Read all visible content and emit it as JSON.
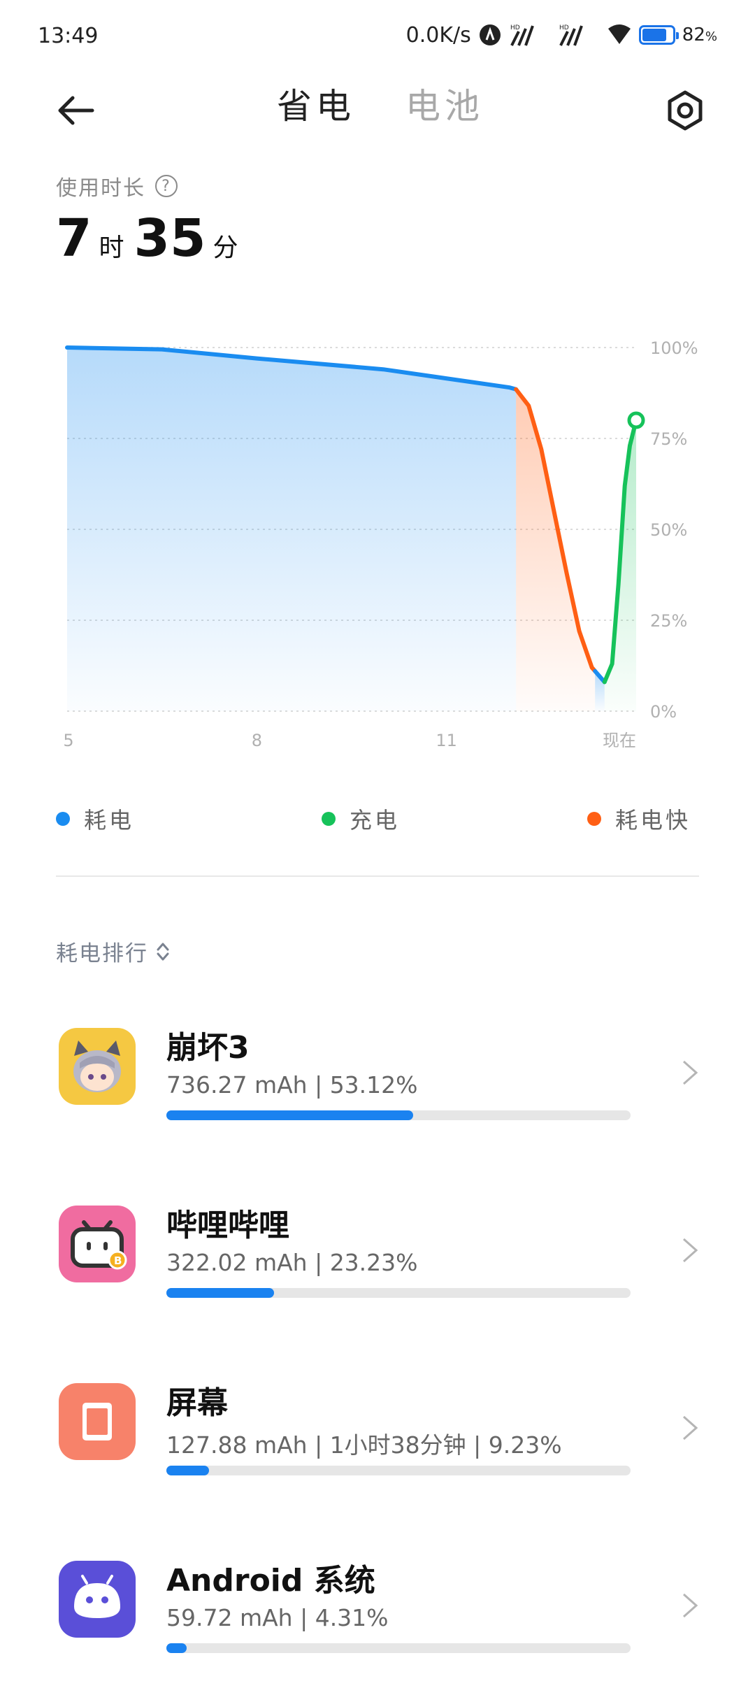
{
  "status_bar": {
    "time": "13:49",
    "net_speed": "0.0K/s",
    "battery_percent_text": "82",
    "battery_level": 0.82
  },
  "header": {
    "tab_active": "省电",
    "tab_inactive": "电池"
  },
  "usage": {
    "label": "使用时长",
    "hours": "7",
    "hours_unit": "时",
    "minutes": "35",
    "minutes_unit": "分"
  },
  "chart_data": {
    "type": "line",
    "x_tick_labels": [
      "5",
      "8",
      "11",
      "现在"
    ],
    "y_tick_labels": [
      "100%",
      "75%",
      "50%",
      "25%",
      "0%"
    ],
    "ylim": [
      0,
      100
    ],
    "grid": true,
    "series": [
      {
        "name": "耗电",
        "color": "#1a8cf0",
        "points": [
          [
            0,
            100
          ],
          [
            1.5,
            99.5
          ],
          [
            3,
            97
          ],
          [
            5,
            94
          ],
          [
            7,
            89
          ],
          [
            7.1,
            88.5
          ]
        ]
      },
      {
        "name": "耗电快",
        "color": "#ff5f14",
        "points": [
          [
            7.1,
            88.5
          ],
          [
            7.3,
            84
          ],
          [
            7.5,
            72
          ],
          [
            7.7,
            55
          ],
          [
            7.9,
            38
          ],
          [
            8.1,
            22
          ],
          [
            8.3,
            12
          ],
          [
            8.35,
            11
          ]
        ]
      },
      {
        "name": "耗电",
        "color": "#1a8cf0",
        "points": [
          [
            8.35,
            11
          ],
          [
            8.5,
            8
          ]
        ]
      },
      {
        "name": "充电",
        "color": "#16c25a",
        "points": [
          [
            8.5,
            8
          ],
          [
            8.62,
            13
          ],
          [
            8.72,
            35
          ],
          [
            8.82,
            62
          ],
          [
            8.9,
            73
          ],
          [
            9,
            80
          ]
        ]
      }
    ],
    "x_range": [
      0,
      9
    ],
    "legend": [
      "耗电",
      "充电",
      "耗电快"
    ]
  },
  "legend": [
    {
      "label": "耗电",
      "color": "#1a8cf0"
    },
    {
      "label": "充电",
      "color": "#16c25a"
    },
    {
      "label": "耗电快",
      "color": "#ff5f14"
    }
  ],
  "ranking": {
    "title": "耗电排行",
    "items": [
      {
        "name": "崩坏3",
        "detail": "736.27 mAh | 53.12%",
        "percent": 53.12,
        "icon": "honkai-icon",
        "icon_bg": "#f5c842"
      },
      {
        "name": "哔哩哔哩",
        "detail": "322.02 mAh | 23.23%",
        "percent": 23.23,
        "icon": "bilibili-icon",
        "icon_bg": "#f06ca0"
      },
      {
        "name": "屏幕",
        "detail": "127.88 mAh | 1小时38分钟 | 9.23%",
        "percent": 9.23,
        "icon": "screen-icon",
        "icon_bg": "#f7826a"
      },
      {
        "name": "Android 系统",
        "detail": "59.72 mAh | 4.31%",
        "percent": 4.31,
        "icon": "android-icon",
        "icon_bg": "#5a4fd8"
      }
    ]
  }
}
